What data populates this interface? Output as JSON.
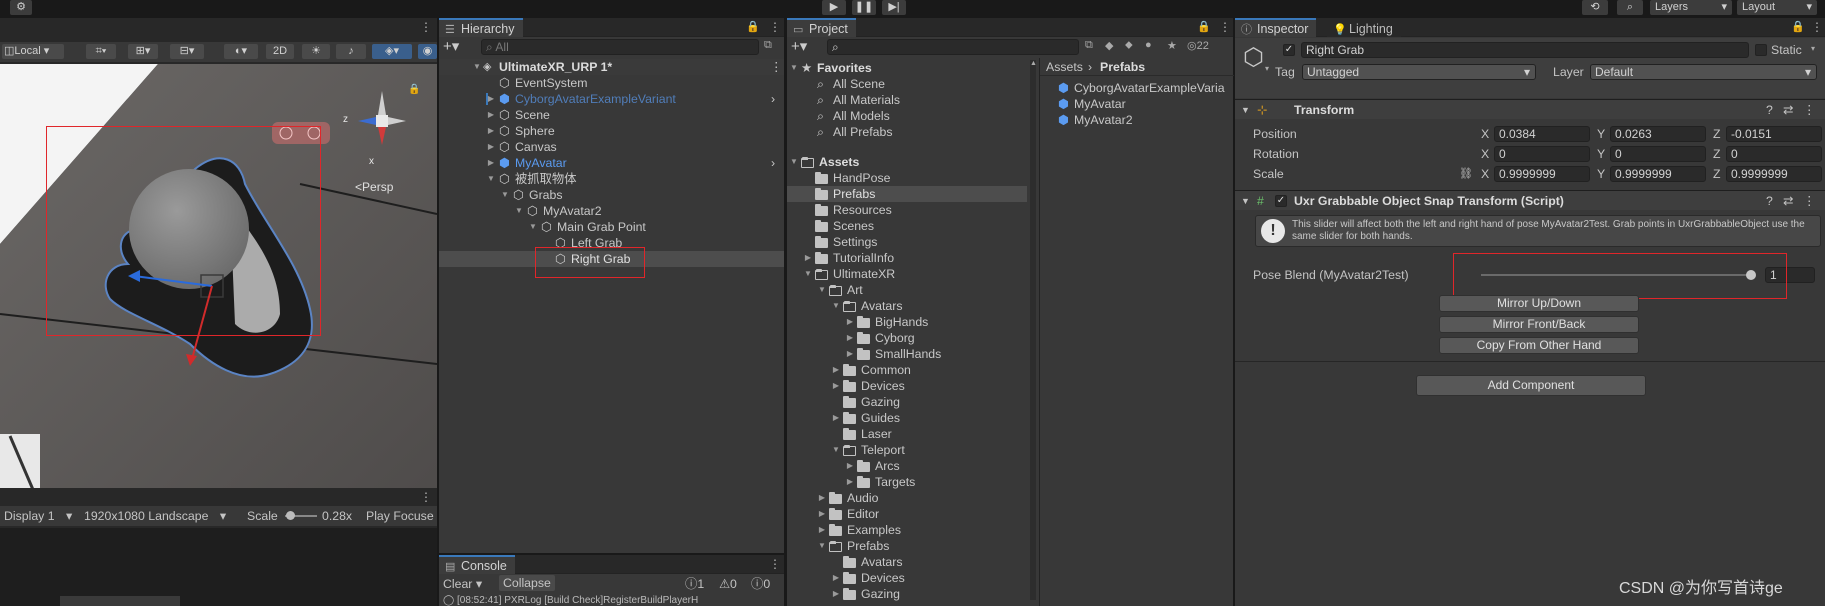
{
  "top_toolbar": {
    "play_icon": "play-icon",
    "pause_icon": "pause-icon",
    "step_icon": "step-icon",
    "layers_label": "Layers",
    "layout_label": "Layout"
  },
  "scene_view": {
    "local_label": "Local",
    "mode_2d": "2D",
    "persp_label": "Persp",
    "gizmo_axes": {
      "z": "z",
      "x": "x"
    }
  },
  "game_view": {
    "display_label": "Display 1",
    "resolution_label": "1920x1080 Landscape",
    "scale_label": "Scale",
    "scale_value": "0.28x",
    "play_focused_label": "Play Focuse"
  },
  "hierarchy": {
    "tab_label": "Hierarchy",
    "search_placeholder": "All",
    "scene_name": "UltimateXR_URP 1*",
    "items": [
      {
        "label": "EventSystem"
      },
      {
        "label": "CyborgAvatarExampleVariant"
      },
      {
        "label": "Scene"
      },
      {
        "label": "Sphere"
      },
      {
        "label": "Canvas"
      },
      {
        "label": "MyAvatar"
      },
      {
        "label": "被抓取物体"
      },
      {
        "label": "Grabs"
      },
      {
        "label": "MyAvatar2"
      },
      {
        "label": "Main Grab Point"
      },
      {
        "label": "Left Grab"
      },
      {
        "label": "Right Grab"
      }
    ]
  },
  "console": {
    "tab_label": "Console",
    "clear_label": "Clear",
    "collapse_label": "Collapse",
    "count_info": "1",
    "count_warn": "0",
    "count_error": "0",
    "log_line": "[08:52:41] PXRLog [Build Check]RegisterBuildPlayerH"
  },
  "project": {
    "tab_label": "Project",
    "favorites_label": "Favorites",
    "favorites": [
      {
        "label": "All Scene"
      },
      {
        "label": "All Materials"
      },
      {
        "label": "All Models"
      },
      {
        "label": "All Prefabs"
      }
    ],
    "assets_label": "Assets",
    "tree": [
      {
        "label": "HandPose"
      },
      {
        "label": "Prefabs"
      },
      {
        "label": "Resources"
      },
      {
        "label": "Scenes"
      },
      {
        "label": "Settings"
      },
      {
        "label": "TutorialInfo"
      },
      {
        "label": "UltimateXR"
      },
      {
        "label": "Art"
      },
      {
        "label": "Avatars"
      },
      {
        "label": "BigHands"
      },
      {
        "label": "Cyborg"
      },
      {
        "label": "SmallHands"
      },
      {
        "label": "Common"
      },
      {
        "label": "Devices"
      },
      {
        "label": "Gazing"
      },
      {
        "label": "Guides"
      },
      {
        "label": "Laser"
      },
      {
        "label": "Teleport"
      },
      {
        "label": "Arcs"
      },
      {
        "label": "Targets"
      },
      {
        "label": "Audio"
      },
      {
        "label": "Editor"
      },
      {
        "label": "Examples"
      },
      {
        "label": "Prefabs"
      },
      {
        "label": "Avatars"
      },
      {
        "label": "Devices"
      },
      {
        "label": "Gazing"
      }
    ],
    "breadcrumb": [
      "Assets",
      "Prefabs"
    ],
    "hidden_count": "22",
    "files": [
      {
        "label": "CyborgAvatarExampleVaria"
      },
      {
        "label": "MyAvatar"
      },
      {
        "label": "MyAvatar2"
      }
    ]
  },
  "inspector": {
    "tab_label": "Inspector",
    "lighting_tab_label": "Lighting",
    "object_name": "Right Grab",
    "static_label": "Static",
    "tag_label": "Tag",
    "tag_value": "Untagged",
    "layer_label": "Layer",
    "layer_value": "Default",
    "transform": {
      "title": "Transform",
      "position_label": "Position",
      "rotation_label": "Rotation",
      "scale_label": "Scale",
      "axis_x": "X",
      "axis_y": "Y",
      "axis_z": "Z",
      "position": [
        "0.0384",
        "0.0263",
        "-0.0151"
      ],
      "rotation": [
        "0",
        "0",
        "0"
      ],
      "scale": [
        "0.9999999",
        "0.9999999",
        "0.9999999"
      ]
    },
    "script": {
      "title": "Uxr Grabbable Object Snap Transform (Script)",
      "help_text": "This slider will affect both the left and right hand of pose MyAvatar2Test. Grab points in UxrGrabbableObject use the same slider for both hands.",
      "pose_blend_label": "Pose Blend (MyAvatar2Test)",
      "pose_blend_value": "1",
      "pose_blend_level": 1.0,
      "mirror_up_down": "Mirror Up/Down",
      "mirror_front_back": "Mirror Front/Back",
      "copy_from_other": "Copy From Other Hand"
    },
    "add_component": "Add Component"
  },
  "watermark": "CSDN @为你写首诗ge"
}
